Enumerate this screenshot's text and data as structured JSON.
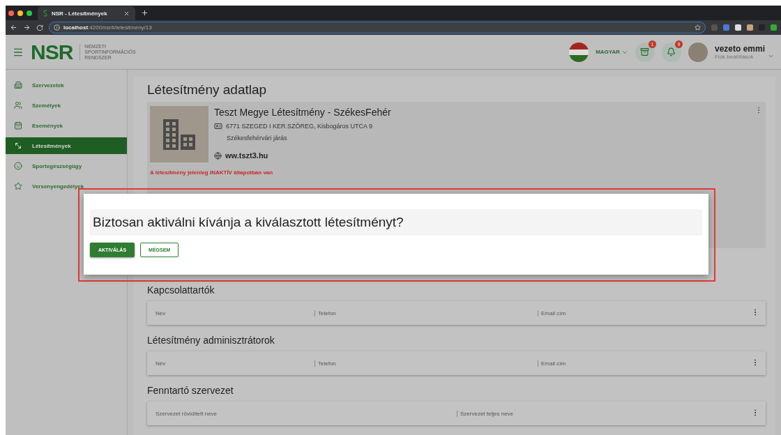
{
  "browser": {
    "tab_title": "NSR - Létesítmények",
    "url": "**localhost**:4200/nsr#/letesitmeny/13"
  },
  "header": {
    "logo": "NSR",
    "logo_subtitle": [
      "NEMZETI",
      "SPORTINFORMÁCIÓS",
      "RENDSZER"
    ],
    "language": "MAGYAR",
    "tasks_badge": "1",
    "notifications_badge": "9",
    "user_name": "vezeto emmi",
    "user_link": "Fiók beállítások"
  },
  "sidebar": {
    "items": [
      {
        "label": "Szervezetek",
        "selected": false
      },
      {
        "label": "Személyek",
        "selected": false
      },
      {
        "label": "Események",
        "selected": false
      },
      {
        "label": "Létesítmények",
        "selected": true
      },
      {
        "label": "Sportegészségügy",
        "selected": false
      },
      {
        "label": "Versenyengedélyek",
        "selected": false
      }
    ]
  },
  "page": {
    "title": "Létesítmény adatlap"
  },
  "facility": {
    "name": "Teszt Megye Létesítmény - SzékesFehér",
    "address": "6771 SZEGED I KER.SZÖREG, Kisbogáros UTCA 9",
    "district": "Székesfehérvári járás",
    "website": "ww.tszt3.hu",
    "status_warning": "A létesítmény jelenleg INAKTÍV állapotban van"
  },
  "dialog": {
    "question": "Biztosan aktiválni kívánja a kiválasztott létesítményt?",
    "buttons": [
      {
        "label": "AKTIVÁLÁS",
        "kind": "primary"
      },
      {
        "label": "MÉGSEM",
        "kind": "outline"
      }
    ]
  },
  "sections": [
    {
      "title": "Kapcsolattartók",
      "columns": [
        "Név",
        "Telefon",
        "Email cím"
      ]
    },
    {
      "title": "Létesítmény adminisztrátorok",
      "columns": [
        "Név",
        "Telefon",
        "Email cím"
      ]
    },
    {
      "title": "Fenntartó szervezet",
      "columns": [
        "Szervezet rövidített neve",
        "Szervezet teljes neve"
      ]
    }
  ]
}
